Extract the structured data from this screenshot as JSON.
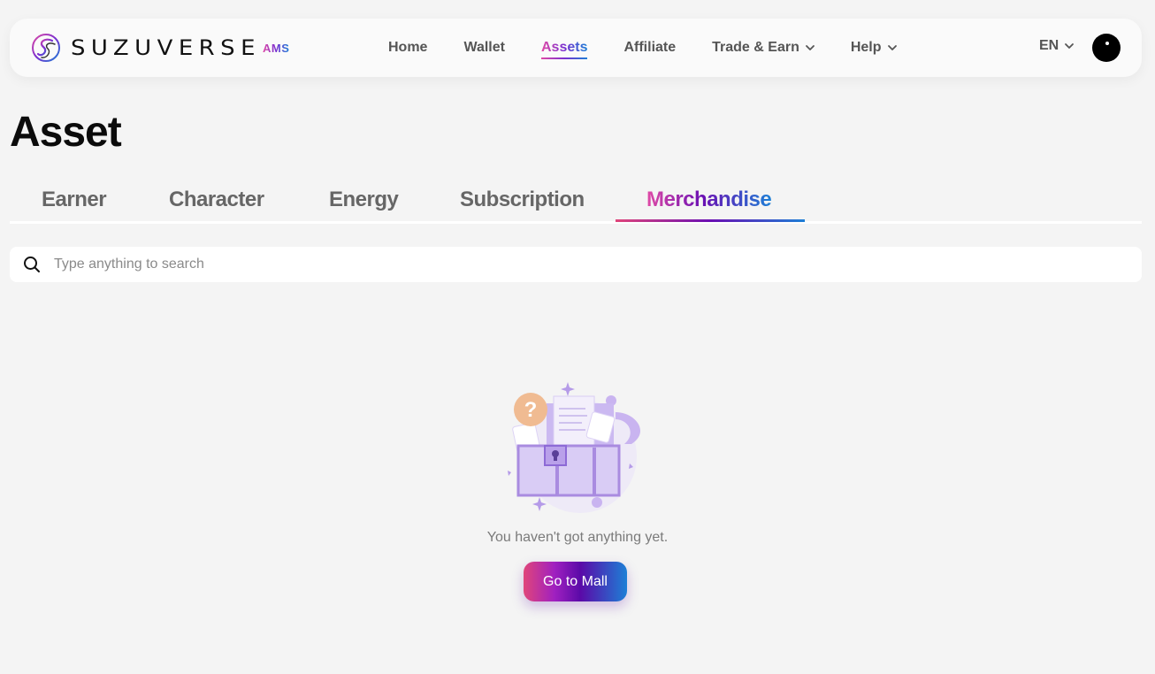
{
  "brand": {
    "name": "SUZUVERSE",
    "sub": "AMS"
  },
  "nav": {
    "items": [
      {
        "label": "Home"
      },
      {
        "label": "Wallet"
      },
      {
        "label": "Assets",
        "active": true
      },
      {
        "label": "Affiliate"
      },
      {
        "label": "Trade & Earn",
        "dropdown": true
      },
      {
        "label": "Help",
        "dropdown": true
      }
    ],
    "language": "EN"
  },
  "page": {
    "title": "Asset"
  },
  "tabs": [
    {
      "label": "Earner"
    },
    {
      "label": "Character"
    },
    {
      "label": "Energy"
    },
    {
      "label": "Subscription"
    },
    {
      "label": "Merchandise",
      "active": true
    }
  ],
  "search": {
    "placeholder": "Type anything to search",
    "value": ""
  },
  "empty_state": {
    "message": "You haven't got anything yet.",
    "button_label": "Go to Mall"
  },
  "colors": {
    "accent_pink": "#e04aa6",
    "accent_purple": "#6a0fb3",
    "accent_blue": "#1d7fd6",
    "background": "#f4f4f4"
  }
}
